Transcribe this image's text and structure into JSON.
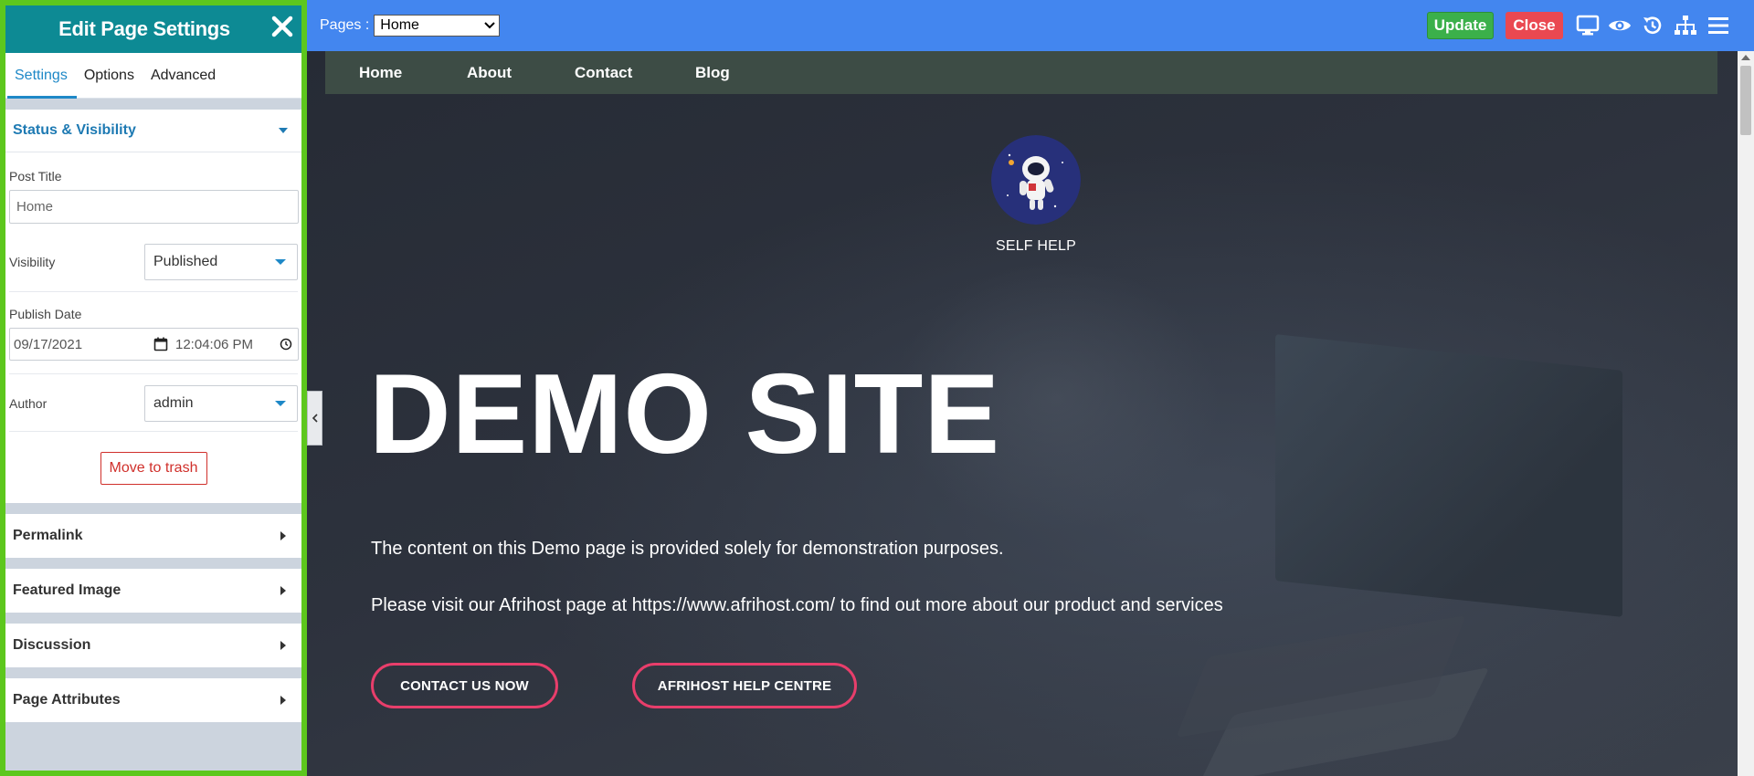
{
  "panel": {
    "title": "Edit Page Settings",
    "tabs": [
      "Settings",
      "Options",
      "Advanced"
    ],
    "active_tab": "Settings",
    "status_section": {
      "title": "Status & Visibility",
      "post_title_label": "Post Title",
      "post_title_value": "Home",
      "visibility_label": "Visibility",
      "visibility_value": "Published",
      "publish_date_label": "Publish Date",
      "publish_date_value": "09/17/2021",
      "publish_time_value": "12:04:06 PM",
      "author_label": "Author",
      "author_value": "admin",
      "trash_label": "Move to trash"
    },
    "collapsed_sections": [
      "Permalink",
      "Featured Image",
      "Discussion",
      "Page Attributes"
    ]
  },
  "topbar": {
    "pages_label": "Pages :",
    "pages_value": "Home",
    "update_label": "Update",
    "close_label": "Close",
    "icons": [
      "desktop-icon",
      "eye-icon",
      "history-icon",
      "sitemap-icon",
      "menu-icon"
    ]
  },
  "preview": {
    "nav": [
      "Home",
      "About",
      "Contact",
      "Blog"
    ],
    "logo_text": "SELF HELP",
    "hero_title": "DEMO SITE",
    "paragraph_1": "The content on this Demo page is provided solely for demonstration purposes.",
    "paragraph_2": "Please visit our Afrihost page at https://www.afrihost.com/ to find out more about our product and services",
    "cta_1": "CONTACT US NOW",
    "cta_2": "AFRIHOST HELP CENTRE"
  },
  "colors": {
    "panel_header": "#0d8a94",
    "panel_border": "#5dc71d",
    "topbar": "#4386ef",
    "update": "#3bb04a",
    "close": "#ea4851",
    "cta_border": "#e83e6b",
    "accent": "#1e88c7"
  }
}
